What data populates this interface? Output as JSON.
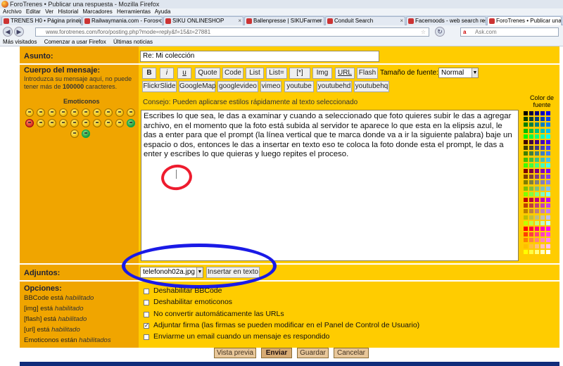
{
  "browser": {
    "window_title": "ForoTrenes • Publicar una respuesta - Mozilla Firefox",
    "menu": [
      "Archivo",
      "Editar",
      "Ver",
      "Historial",
      "Marcadores",
      "Herramientas",
      "Ayuda"
    ],
    "tabs": [
      {
        "label": "TRENES H0 • Página principal"
      },
      {
        "label": "Railwaymania.com - Foros de disc..."
      },
      {
        "label": "SIKU ONLINESHOP"
      },
      {
        "label": "Ballenpresse | SIKUFarmer - Grünla..."
      },
      {
        "label": "Conduit Search"
      },
      {
        "label": "Facemoods - web search results - ..."
      },
      {
        "label": "ForoTrenes • Publicar una respuesta"
      }
    ],
    "url": "www.forotrenes.com/foro/posting.php?mode=reply&f=15&t=27881",
    "search_placeholder": "Ask.com",
    "bookmarks": [
      "Más visitados",
      "Comenzar a usar Firefox",
      "Últimas noticias"
    ]
  },
  "form": {
    "asunto_label": "Asunto:",
    "asunto_value": "Re: Mi colección",
    "cuerpo_label": "Cuerpo del mensaje:",
    "cuerpo_help_1": "Introduzca su mensaje aquí, no puede",
    "cuerpo_help_2": "tener más de",
    "cuerpo_help_bold": "100000",
    "cuerpo_help_3": "caracteres.",
    "emoticonos_label": "Emoticonos",
    "bbcode_row1": [
      "B",
      "i",
      "u",
      "Quote",
      "Code",
      "List",
      "List=",
      "[*]",
      "Img",
      "URL",
      "Flash"
    ],
    "bbcode_row2": [
      "FlickrSlide",
      "GoogleMap",
      "googlevideo",
      "vimeo",
      "youtube",
      "youtubehd",
      "youtubehq"
    ],
    "font_size_label": "Tamaño de fuente:",
    "font_size_value": "Normal",
    "tip": "Consejo: Pueden aplicarse estilos rápidamente al texto seleccionado",
    "color_label_1": "Color de",
    "color_label_2": "fuente",
    "message_text": "Escribes lo que sea, le das a examinar y cuando a seleccionado que foto quieres subir le das a agregar archivo, en el momento que la foto está subida al servidor te aparece lo que esta en la elipsis azul, le das a enter para que el prompt (la línea vertical que te marca donde va a ir la siguiente palabra) baje un espacio o dos, entonces le das a insertar en texto eso te coloca la foto donde esta el prompt, le das a enter y escribes lo que quieras y luego repites el proceso.",
    "adjuntos_label": "Adjuntos:",
    "adjunto_file": "telefonoh02a.jpg",
    "insertar_label": "Insertar en texto",
    "opciones_label": "Opciones:",
    "opciones_status": [
      {
        "name": "BBCode está",
        "state": "habilitado"
      },
      {
        "name": "[img] está",
        "state": "habilitado"
      },
      {
        "name": "[flash] está",
        "state": "habilitado"
      },
      {
        "name": "[url] está",
        "state": "habilitado"
      },
      {
        "name": "Emoticonos están",
        "state": "habilitados"
      }
    ],
    "checkboxes": [
      {
        "label": "Deshabilitar BBCode",
        "checked": false
      },
      {
        "label": "Deshabilitar emoticonos",
        "checked": false
      },
      {
        "label": "No convertir automáticamente las URLs",
        "checked": false
      },
      {
        "label": "Adjuntar firma (las firmas se pueden modificar en el Panel de Control de Usuario)",
        "checked": true
      },
      {
        "label": "Enviarme un email cuando un mensaje es respondido",
        "checked": false
      }
    ],
    "buttons": {
      "preview": "Vista previa",
      "submit": "Enviar",
      "save": "Guardar",
      "cancel": "Cancelar"
    }
  },
  "colors": {
    "form_bg": "#ffcc00",
    "label_bg": "#f0a500",
    "annotation_red": "#ee1c2e",
    "annotation_blue": "#1a1ae6"
  }
}
